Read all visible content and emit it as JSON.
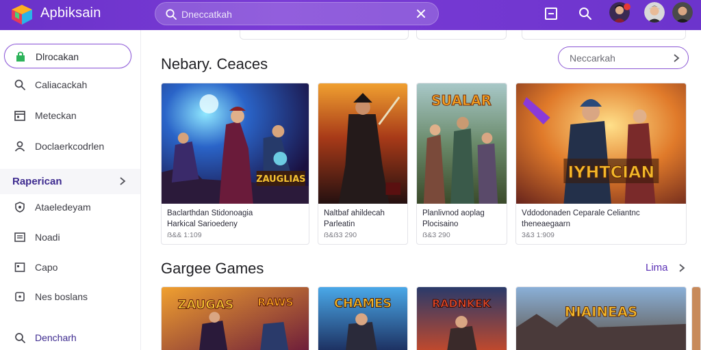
{
  "app": {
    "title": "Apbiksain"
  },
  "search": {
    "placeholder": "Dneccatkah"
  },
  "sidebar": {
    "items": [
      {
        "label": "Dlrocakan",
        "icon": "store-icon",
        "active": true
      },
      {
        "label": "Caliacackah",
        "icon": "search-icon"
      },
      {
        "label": "Meteckan",
        "icon": "calendar-icon"
      },
      {
        "label": "Doclaerkcodrlen",
        "icon": "person-icon"
      }
    ],
    "section": {
      "label": "Raperican"
    },
    "subitems": [
      {
        "label": "Ataeledeyam",
        "icon": "shield-icon"
      },
      {
        "label": "Noadi",
        "icon": "news-icon"
      },
      {
        "label": "Capo",
        "icon": "box-icon"
      },
      {
        "label": "Nes boslans",
        "icon": "tag-icon"
      }
    ],
    "footer": {
      "label": "Dencharh",
      "icon": "help-icon"
    }
  },
  "section1": {
    "title": "Nebary. Ceaces",
    "action_label": "Neccarkah",
    "cards": [
      {
        "line1": "Baclarthdan Stidonoagia",
        "line2": "Harkical Sarioedeny",
        "meta": "ẞ&& 1:109",
        "thumb_text": "ZAUGLIAS"
      },
      {
        "line1": "Naltbaf ahildecah",
        "line2": "Parleatin",
        "meta": "ẞ&ẞ3 290",
        "thumb_text": ""
      },
      {
        "line1": "Planlivnod aoplag",
        "line2": "Plocisaino",
        "meta": "ẞ&3 290",
        "thumb_text": "SUALAR"
      },
      {
        "line1": "Vddodonaden Ceparale Celiantnc",
        "line2": "theneaegaarn",
        "meta": "3&3 1:909",
        "thumb_text": "IYHTCIAN"
      }
    ]
  },
  "section2": {
    "title": "Gargee Games",
    "more_label": "Lima",
    "cards": [
      {
        "thumb_text": "ZAUGAS",
        "thumb_text2": "RAWS"
      },
      {
        "thumb_text": "CHAMES"
      },
      {
        "thumb_text": "RADNKEK"
      },
      {
        "thumb_text": "NIAINEAS"
      }
    ]
  },
  "colors": {
    "brand": "#6a32c9",
    "accent": "#8a56d4",
    "section_text": "#3d2a8f"
  }
}
